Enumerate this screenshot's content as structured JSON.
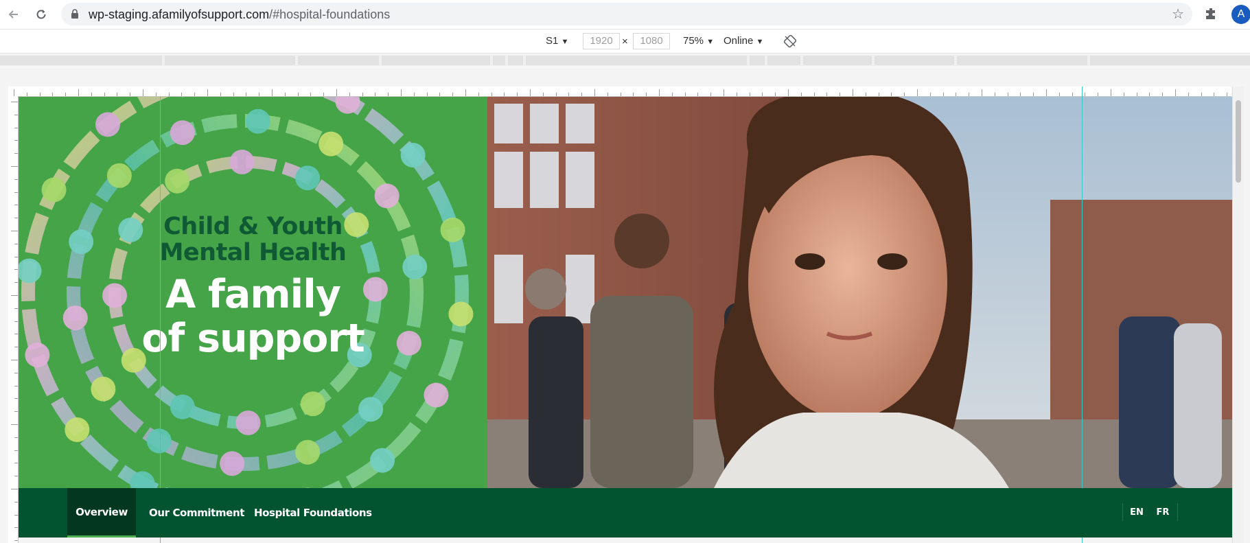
{
  "browser": {
    "url_domain": "wp-staging.afamilyofsupport.com",
    "url_path": "/#hospital-foundations",
    "profile_initial": "A"
  },
  "device_toolbar": {
    "device": "S1",
    "width": "1920",
    "height": "1080",
    "times": "×",
    "zoom": "75%",
    "network": "Online",
    "dropdown_glyph": "▼"
  },
  "hero": {
    "subtitle_line1": "Child & Youth",
    "subtitle_line2": "Mental Health",
    "title_line1": "A family",
    "title_line2": "of support"
  },
  "site_nav": {
    "items": [
      {
        "label": "Overview",
        "active": true
      },
      {
        "label": "Our Commitment",
        "active": false
      },
      {
        "label": "Hospital Foundations",
        "active": false
      }
    ],
    "languages": [
      "EN",
      "FR"
    ]
  },
  "colors": {
    "hero_green": "#45a348",
    "title_dark_green": "#0f5a34",
    "nav_bg": "#02532f",
    "nav_active_bg": "#04371f",
    "nav_active_underline": "#4caf50",
    "guide_line": "#3bc8c8"
  },
  "icons": [
    "back-arrow-icon",
    "reload-icon",
    "lock-icon",
    "star-icon",
    "extensions-icon",
    "rotate-icon"
  ]
}
